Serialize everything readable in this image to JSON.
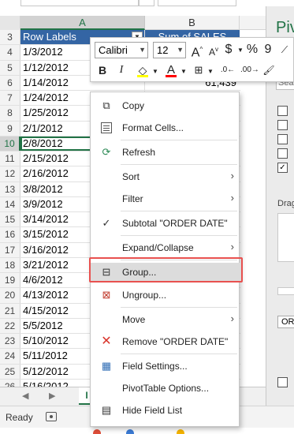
{
  "column_headers": {
    "a": "A",
    "b": "B"
  },
  "pivot_header": {
    "row_labels": "Row Labels",
    "sum_label": "Sum of SALES"
  },
  "rows": [
    {
      "num": "3",
      "a": "",
      "b": ""
    },
    {
      "num": "4",
      "a": "1/3/2012",
      "b": ""
    },
    {
      "num": "5",
      "a": "1/12/2012",
      "b": ""
    },
    {
      "num": "6",
      "a": "1/14/2012",
      "b": "61,439"
    },
    {
      "num": "7",
      "a": "1/24/2012",
      "b": ""
    },
    {
      "num": "8",
      "a": "1/25/2012",
      "b": ""
    },
    {
      "num": "9",
      "a": "2/1/2012",
      "b": ""
    },
    {
      "num": "10",
      "a": "2/8/2012",
      "b": ""
    },
    {
      "num": "11",
      "a": "2/15/2012",
      "b": ""
    },
    {
      "num": "12",
      "a": "2/16/2012",
      "b": ""
    },
    {
      "num": "13",
      "a": "3/8/2012",
      "b": ""
    },
    {
      "num": "14",
      "a": "3/9/2012",
      "b": ""
    },
    {
      "num": "15",
      "a": "3/14/2012",
      "b": ""
    },
    {
      "num": "16",
      "a": "3/15/2012",
      "b": ""
    },
    {
      "num": "17",
      "a": "3/16/2012",
      "b": ""
    },
    {
      "num": "18",
      "a": "3/21/2012",
      "b": ""
    },
    {
      "num": "19",
      "a": "4/6/2012",
      "b": ""
    },
    {
      "num": "20",
      "a": "4/13/2012",
      "b": ""
    },
    {
      "num": "21",
      "a": "4/15/2012",
      "b": ""
    },
    {
      "num": "22",
      "a": "5/5/2012",
      "b": ""
    },
    {
      "num": "23",
      "a": "5/10/2012",
      "b": ""
    },
    {
      "num": "24",
      "a": "5/11/2012",
      "b": ""
    },
    {
      "num": "25",
      "a": "5/12/2012",
      "b": ""
    },
    {
      "num": "26",
      "a": "5/16/2012",
      "b": ""
    }
  ],
  "mini_toolbar": {
    "font": "Calibri",
    "size": "12",
    "grow_font": "A",
    "shrink_font": "A",
    "currency": "$",
    "percent": "%",
    "comma": "9",
    "bold": "B",
    "italic": "I",
    "font_color": "A"
  },
  "context_menu": {
    "copy": "Copy",
    "format_cells": "Format Cells...",
    "refresh": "Refresh",
    "sort": "Sort",
    "filter": "Filter",
    "subtotal": "Subtotal \"ORDER DATE\"",
    "expand_collapse": "Expand/Collapse",
    "group": "Group...",
    "ungroup": "Ungroup...",
    "move": "Move",
    "remove": "Remove \"ORDER DATE\"",
    "field_settings": "Field Settings...",
    "pivot_options": "PivotTable Options...",
    "hide_field_list": "Hide Field List"
  },
  "pivot_panel": {
    "title": "Piv",
    "search": "Sear",
    "drag_label": "Drag",
    "or_field": "OR"
  },
  "sheet_tab": "I",
  "status": "Ready",
  "colors": {
    "accent": "#217346",
    "pivot_header": "#3465a4",
    "highlight": "#e8514f"
  }
}
